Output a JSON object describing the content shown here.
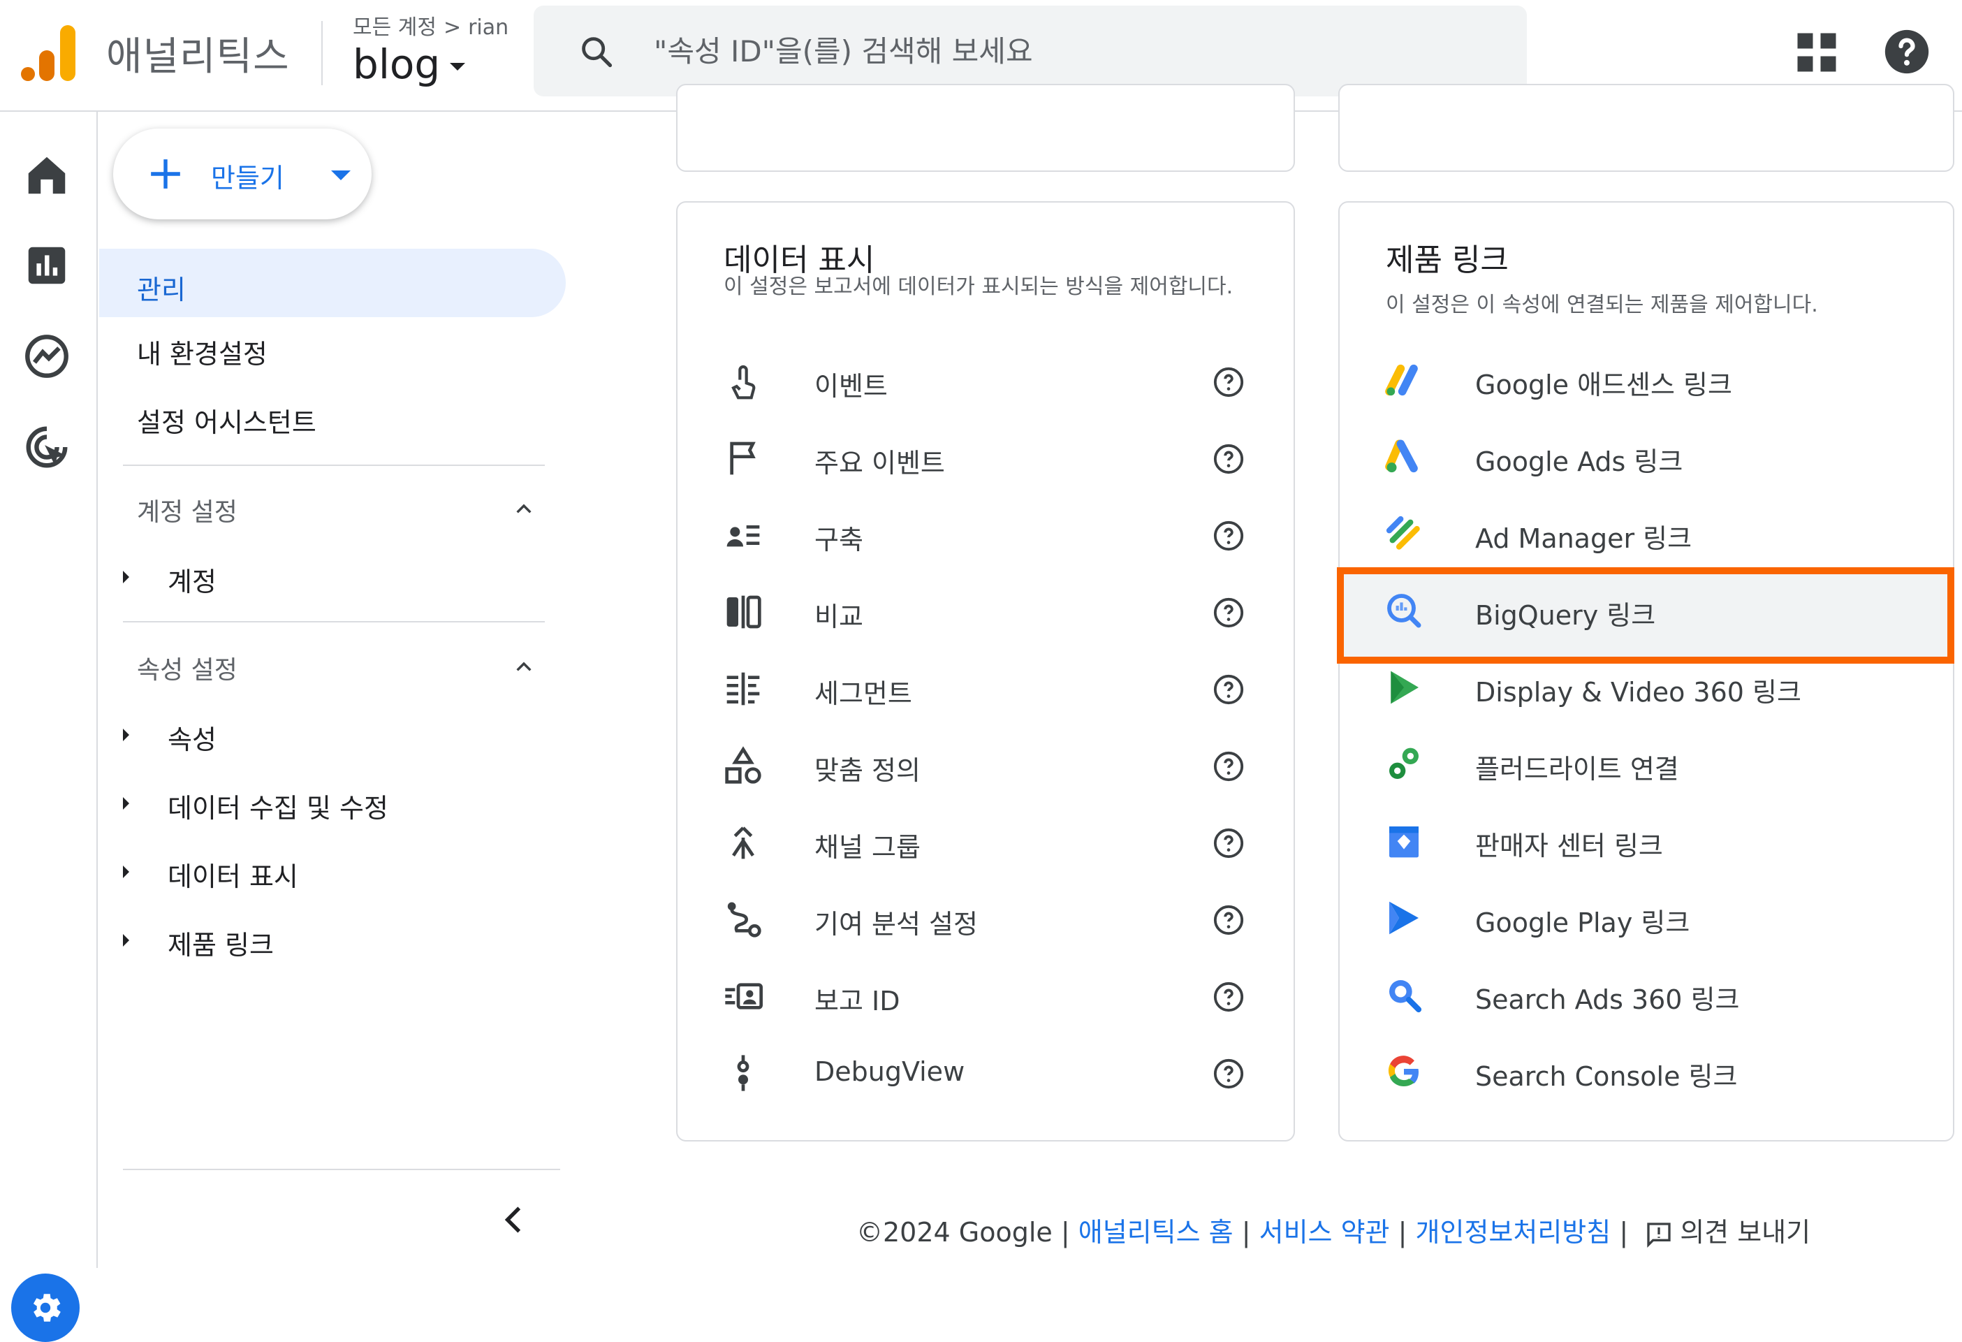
{
  "header": {
    "app_name": "애널리틱스",
    "breadcrumb_all": "모든 계정",
    "breadcrumb_sep": ">",
    "breadcrumb_account": "rian",
    "property": "blog",
    "search_placeholder": "\"속성 ID\"을(를) 검색해 보세요"
  },
  "leftnav": {
    "create_label": "만들기",
    "admin": "관리",
    "my_prefs": "내 환경설정",
    "setup_assistant": "설정 어시스턴트",
    "account_settings": "계정 설정",
    "account": "계정",
    "property_settings": "속성 설정",
    "property_items": [
      "속성",
      "데이터 수집 및 수정",
      "데이터 표시",
      "제품 링크"
    ]
  },
  "data_display": {
    "title": "데이터 표시",
    "description": "이 설정은 보고서에 데이터가 표시되는 방식을 제어합니다.",
    "items": [
      "이벤트",
      "주요 이벤트",
      "구축",
      "비교",
      "세그먼트",
      "맞춤 정의",
      "채널 그룹",
      "기여 분석 설정",
      "보고 ID",
      "DebugView"
    ]
  },
  "product_links": {
    "title": "제품 링크",
    "description": "이 설정은 이 속성에 연결되는 제품을 제어합니다.",
    "items": [
      "Google 애드센스 링크",
      "Google Ads 링크",
      "Ad Manager 링크",
      "BigQuery 링크",
      "Display & Video 360 링크",
      "플러드라이트 연결",
      "판매자 센터 링크",
      "Google Play 링크",
      "Search Ads 360 링크",
      "Search Console 링크"
    ],
    "highlighted": "BigQuery 링크"
  },
  "footer": {
    "copyright": "©2024 Google",
    "sep": "|",
    "home": "애널리틱스 홈",
    "terms": "서비스 약관",
    "privacy": "개인정보처리방침",
    "feedback": "의견 보내기"
  },
  "colors": {
    "accent": "#1a73e8",
    "highlight_border": "#fa6400",
    "logo_orange": "#e37400",
    "logo_yellow": "#f9ab00"
  }
}
